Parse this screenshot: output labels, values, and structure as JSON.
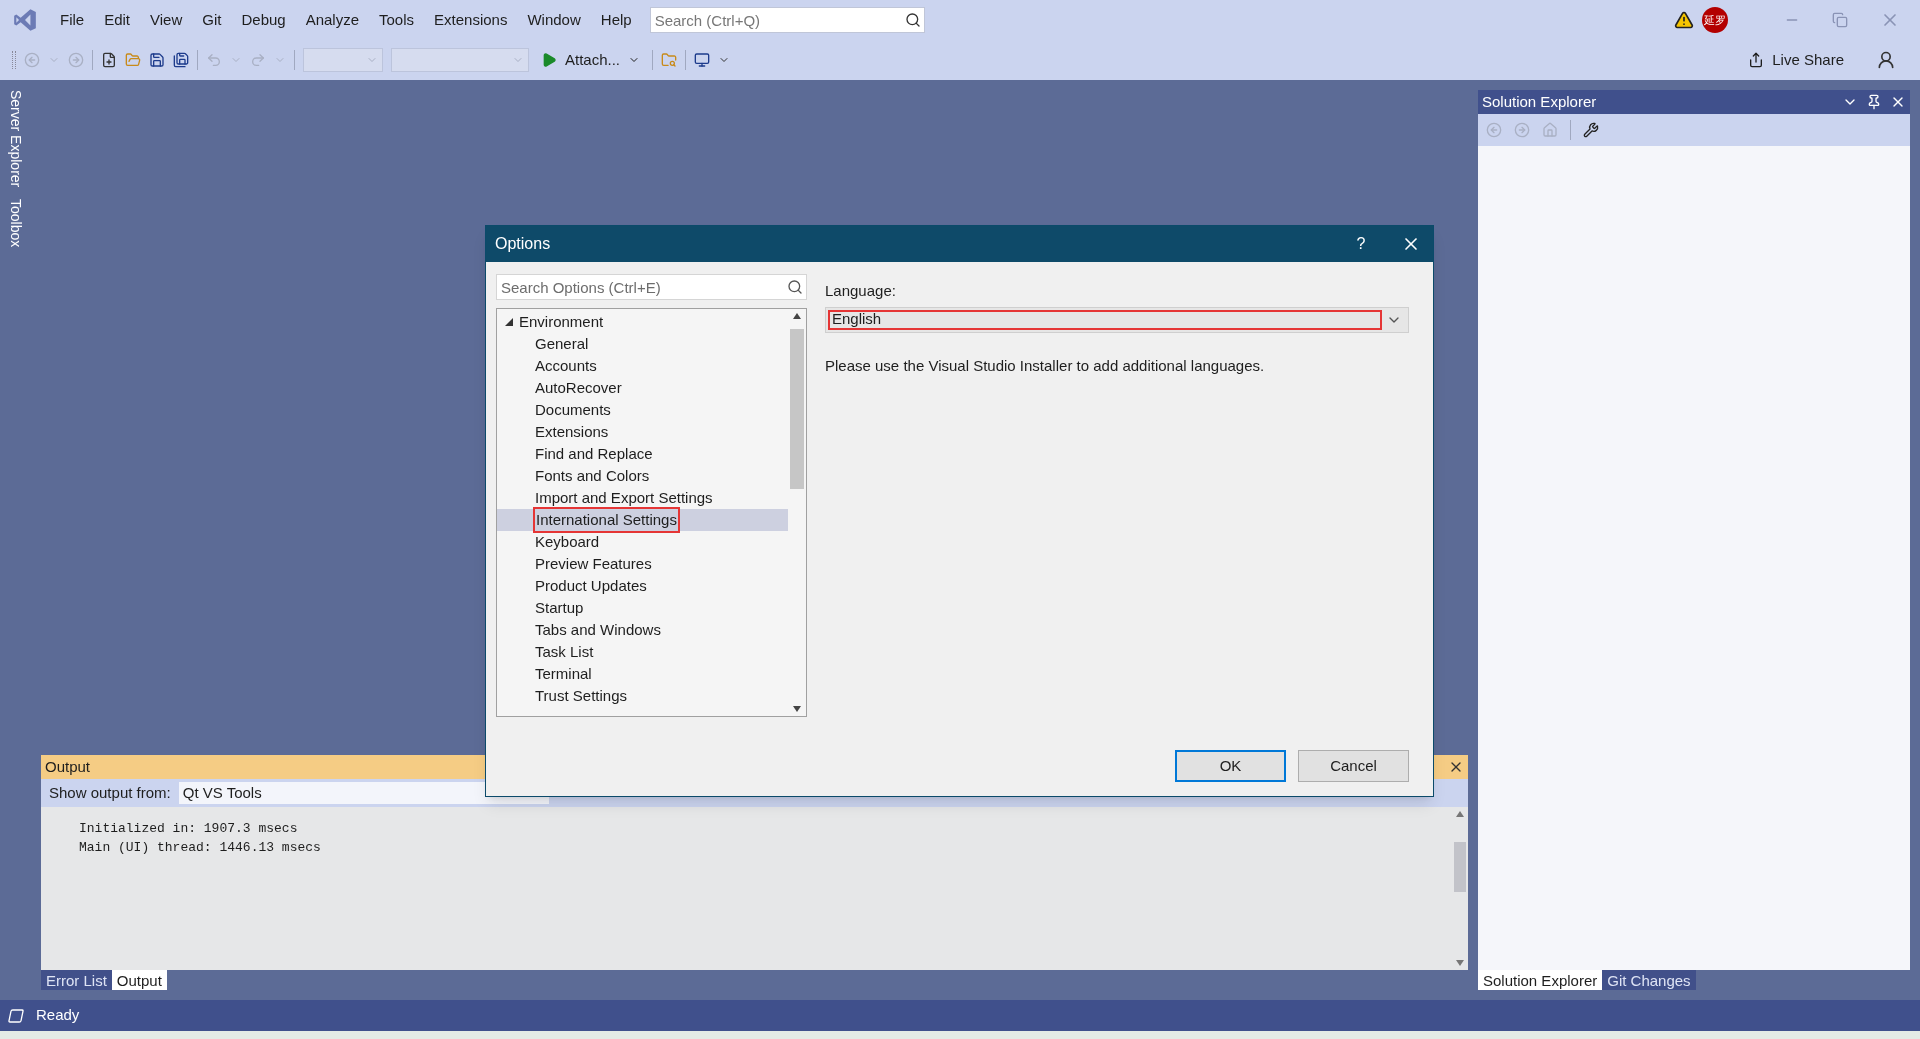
{
  "app": {
    "menu": [
      "File",
      "Edit",
      "View",
      "Git",
      "Debug",
      "Analyze",
      "Tools",
      "Extensions",
      "Window",
      "Help"
    ],
    "search": {
      "placeholder": "Search (Ctrl+Q)"
    },
    "avatar": "延罗",
    "live_share": "Live Share",
    "run_label": "Attach..."
  },
  "side_tabs": [
    "Server Explorer",
    "Toolbox"
  ],
  "solution_explorer": {
    "title": "Solution Explorer"
  },
  "output": {
    "title": "Output",
    "show_from_label": "Show output from:",
    "source": "Qt VS Tools",
    "lines": [
      "Initialized in: 1907.3 msecs",
      "Main (UI) thread: 1446.13 msecs"
    ]
  },
  "bottom_tabs": [
    {
      "label": "Error List",
      "selected": false
    },
    {
      "label": "Output",
      "selected": true
    }
  ],
  "right_tabs": [
    {
      "label": "Solution Explorer",
      "selected": true
    },
    {
      "label": "Git Changes",
      "selected": false
    }
  ],
  "status": "Ready",
  "dialog": {
    "title": "Options",
    "help": "?",
    "search": {
      "placeholder": "Search Options (Ctrl+E)"
    },
    "tree": [
      {
        "label": "Environment",
        "expanded": true,
        "selected": false,
        "highlighted": false,
        "children": [
          {
            "label": "General",
            "selected": false,
            "highlighted": false
          },
          {
            "label": "Accounts",
            "selected": false,
            "highlighted": false
          },
          {
            "label": "AutoRecover",
            "selected": false,
            "highlighted": false
          },
          {
            "label": "Documents",
            "selected": false,
            "highlighted": false
          },
          {
            "label": "Extensions",
            "selected": false,
            "highlighted": false
          },
          {
            "label": "Find and Replace",
            "selected": false,
            "highlighted": false
          },
          {
            "label": "Fonts and Colors",
            "selected": false,
            "highlighted": false
          },
          {
            "label": "Import and Export Settings",
            "selected": false,
            "highlighted": false
          },
          {
            "label": "International Settings",
            "selected": true,
            "highlighted": true
          },
          {
            "label": "Keyboard",
            "selected": false,
            "highlighted": false
          },
          {
            "label": "Preview Features",
            "selected": false,
            "highlighted": false
          },
          {
            "label": "Product Updates",
            "selected": false,
            "highlighted": false
          },
          {
            "label": "Startup",
            "selected": false,
            "highlighted": false
          },
          {
            "label": "Tabs and Windows",
            "selected": false,
            "highlighted": false
          },
          {
            "label": "Task List",
            "selected": false,
            "highlighted": false
          },
          {
            "label": "Terminal",
            "selected": false,
            "highlighted": false
          },
          {
            "label": "Trust Settings",
            "selected": false,
            "highlighted": false
          }
        ]
      }
    ],
    "language_label": "Language:",
    "language": {
      "value": "English",
      "highlighted": true
    },
    "note": "Please use the Visual Studio Installer to add additional languages.",
    "buttons": [
      {
        "label": "OK",
        "default": true
      },
      {
        "label": "Cancel",
        "default": false
      }
    ]
  }
}
